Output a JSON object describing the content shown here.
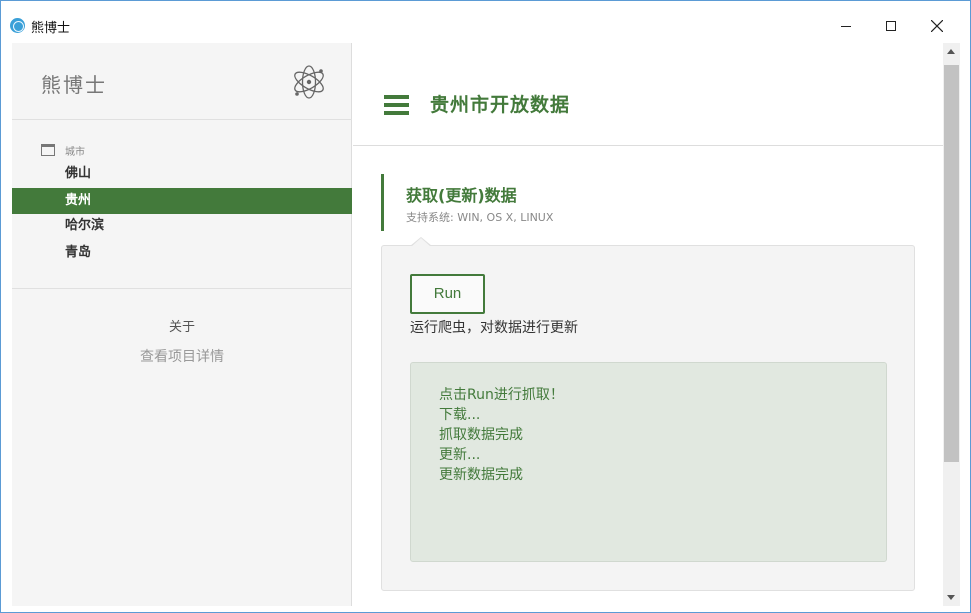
{
  "window": {
    "title": "熊博士",
    "controls": [
      "minimize-icon",
      "maximize-icon",
      "close-icon"
    ]
  },
  "sidebar": {
    "brand": "熊博士",
    "logo_icon": "atom-icon",
    "section_label": "城市",
    "section_icon": "window-icon",
    "cities": [
      {
        "label": "佛山",
        "active": false
      },
      {
        "label": "贵州",
        "active": true
      },
      {
        "label": "哈尔滨",
        "active": false
      },
      {
        "label": "青岛",
        "active": false
      }
    ],
    "about": "关于",
    "details_link": "查看项目详情"
  },
  "header": {
    "menu_icon": "hamburger-icon",
    "title": "贵州市开放数据"
  },
  "section": {
    "title": "获取(更新)数据",
    "subtitle": "支持系统: WIN, OS X, LINUX"
  },
  "panel": {
    "run_label": "Run",
    "run_description": "运行爬虫，对数据进行更新",
    "log": [
      "点击Run进行抓取！",
      "下载...",
      "抓取数据完成",
      "更新...",
      "更新数据完成"
    ]
  },
  "colors": {
    "accent": "#437a3b",
    "log_background": "#e1e8e0",
    "sidebar_background": "#f5f5f5"
  }
}
